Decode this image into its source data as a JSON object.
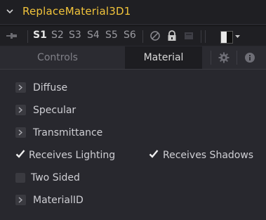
{
  "header": {
    "title": "ReplaceMaterial3D1"
  },
  "toolbar": {
    "slots": [
      "S1",
      "S2",
      "S3",
      "S4",
      "S5",
      "S6"
    ],
    "active_slot": "S1"
  },
  "tabs": [
    {
      "label": "Controls",
      "active": false
    },
    {
      "label": "Material",
      "active": true
    }
  ],
  "sections": [
    {
      "label": "Diffuse"
    },
    {
      "label": "Specular"
    },
    {
      "label": "Transmittance"
    }
  ],
  "checkboxes": {
    "receives_lighting": {
      "label": "Receives Lighting",
      "checked": true
    },
    "receives_shadows": {
      "label": "Receives Shadows",
      "checked": true
    },
    "two_sided": {
      "label": "Two Sided",
      "checked": false
    }
  },
  "material_id": {
    "label": "MaterialID"
  },
  "colors": {
    "title": "#f1c33b",
    "background": "#28282e",
    "header": "#1f1f23"
  }
}
